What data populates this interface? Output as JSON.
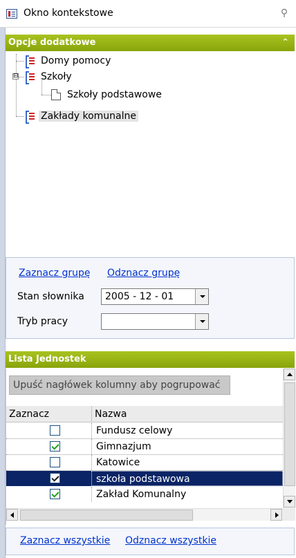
{
  "window": {
    "title": "Okno kontekstowe",
    "icon": "window-list-icon",
    "pin_icon": "pin-icon"
  },
  "section_options": {
    "title": "Opcje dodatkowe",
    "collapse_icon": "chevron-double-up-icon"
  },
  "tree": {
    "nodes": [
      {
        "label": "Domy pomocy",
        "icon": "list-icon"
      },
      {
        "label": "Szkoły",
        "icon": "list-icon",
        "expander": "⊟"
      },
      {
        "label": "Szkoły podstawowe",
        "icon": "document-icon"
      },
      {
        "label": "Zakłady komunalne",
        "icon": "list-icon",
        "selected": true
      }
    ]
  },
  "options": {
    "select_group": "Zaznacz grupę",
    "unselect_group": "Odznacz grupę",
    "dictionary_label": "Stan słownika",
    "dictionary_value": "2005 - 12 - 01",
    "mode_label": "Tryb pracy",
    "mode_value": ""
  },
  "section_list": {
    "title": "Lista Jednostek"
  },
  "grid": {
    "group_hint": "Upuść nagłówek kolumny aby pogrupować",
    "columns": [
      "Zaznacz",
      "Nazwa"
    ],
    "rows": [
      {
        "checked": false,
        "name": "Fundusz celowy",
        "selected": false
      },
      {
        "checked": true,
        "name": "Gimnazjum",
        "selected": false
      },
      {
        "checked": false,
        "name": "Katowice",
        "selected": false
      },
      {
        "checked": true,
        "name": "szkoła podstawowa",
        "selected": true
      },
      {
        "checked": true,
        "name": "Zakład Komunalny",
        "selected": false
      }
    ]
  },
  "footer": {
    "select_all": "Zaznacz wszystkie",
    "unselect_all": "Odznacz wszystkie"
  },
  "colors": {
    "accent": "#9ab515",
    "selection": "#0a2465",
    "link": "#0033cc"
  }
}
